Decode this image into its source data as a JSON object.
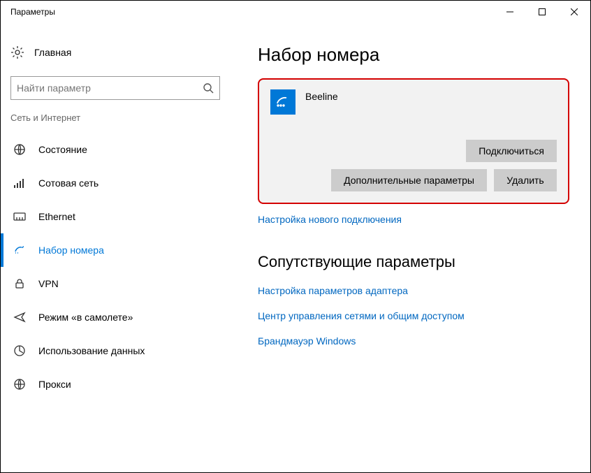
{
  "window": {
    "title": "Параметры"
  },
  "sidebar": {
    "home": "Главная",
    "search_placeholder": "Найти параметр",
    "category": "Сеть и Интернет",
    "items": [
      {
        "label": "Состояние"
      },
      {
        "label": "Сотовая сеть"
      },
      {
        "label": "Ethernet"
      },
      {
        "label": "Набор номера"
      },
      {
        "label": "VPN"
      },
      {
        "label": "Режим «в самолете»"
      },
      {
        "label": "Использование данных"
      },
      {
        "label": "Прокси"
      }
    ]
  },
  "main": {
    "title": "Набор номера",
    "connection": {
      "name": "Beeline",
      "connect": "Подключиться",
      "advanced": "Дополнительные параметры",
      "delete": "Удалить"
    },
    "new_connection": "Настройка нового подключения",
    "related_title": "Сопутствующие параметры",
    "related": [
      "Настройка параметров адаптера",
      "Центр управления сетями и общим доступом",
      "Брандмауэр Windows"
    ]
  }
}
